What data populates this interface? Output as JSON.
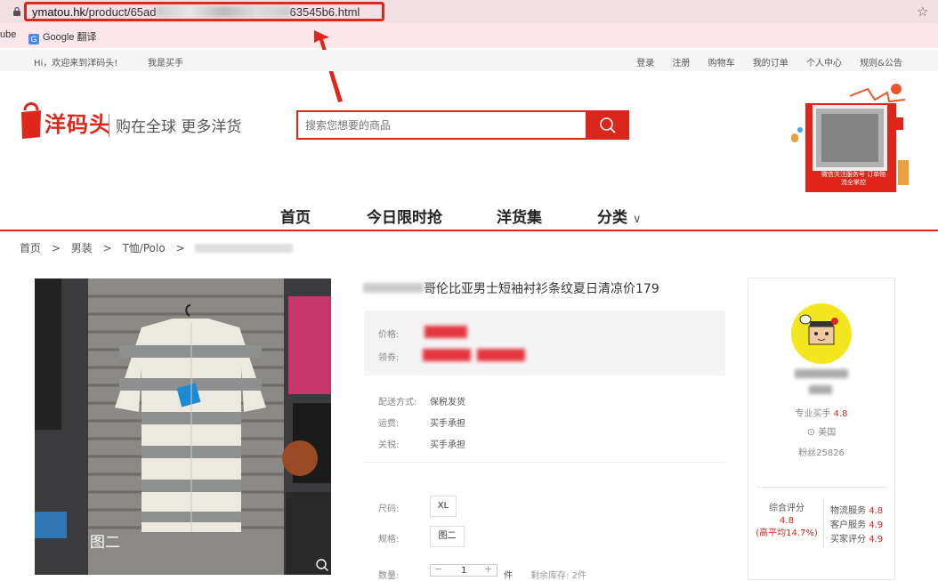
{
  "browser": {
    "url_domain": "ymatou.hk",
    "url_path_start": "/product/65ad",
    "url_path_end": "63545b6.html"
  },
  "bookmarks": {
    "youtube_label": "ube",
    "google_translate_label": "Google 翻译"
  },
  "top_nav": {
    "greeting": "Hi，欢迎来到洋码头!",
    "seller_link": "我是买手",
    "links": [
      "登录",
      "注册",
      "购物车",
      "我的订单",
      "个人中心",
      "规则&公告"
    ]
  },
  "header": {
    "logo_text": "洋码头",
    "slogan": "购在全球 更多洋货",
    "search_placeholder": "搜索您想要的商品",
    "qr_caption": "微信关注服务号 订单物流全掌控"
  },
  "main_nav": {
    "items": [
      "首页",
      "今日限时抢",
      "洋货集",
      "分类"
    ]
  },
  "breadcrumb": {
    "items": [
      "首页",
      ">",
      "男装",
      ">",
      "T恤/Polo",
      ">"
    ]
  },
  "product": {
    "image_caption": "图二",
    "title_visible": "哥伦比亚男士短袖衬衫条纹夏日清凉价179",
    "price_label": "价格:",
    "coupon_label": "领券:",
    "shipping_label": "配送方式:",
    "shipping_value": "保税发货",
    "freight_label": "运费:",
    "freight_value": "买手承担",
    "tax_label": "关税:",
    "tax_value": "买手承担",
    "size_label": "尺码:",
    "size_value": "XL",
    "spec_label": "规格:",
    "spec_value": "图二",
    "qty_label": "数量:",
    "qty_value": "1",
    "qty_unit": "件",
    "stock_text": "剩余库存: 2件"
  },
  "seller": {
    "role": "专业买手",
    "rating": "4.8",
    "location": "美国",
    "fans": "粉丝25826",
    "overall_label": "综合评分",
    "overall_value": "4.8",
    "overall_note": "(高平均14.7%)",
    "logistics_label": "物流服务",
    "logistics_value": "4.8",
    "service_label": "客户服务",
    "service_value": "4.9",
    "buyer_label": "买家评分",
    "buyer_value": "4.9"
  },
  "colors": {
    "brand_red": "#e0261a",
    "avatar_yellow": "#f3e61e"
  }
}
